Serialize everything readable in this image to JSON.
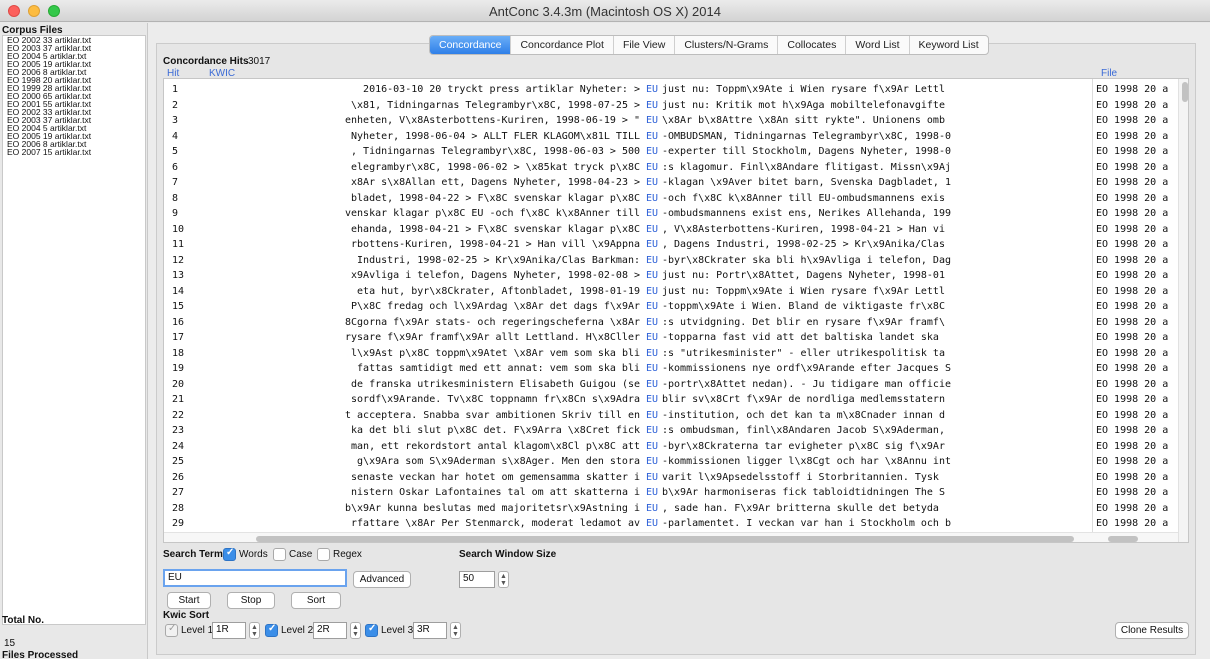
{
  "window": {
    "title": "AntConc 3.4.3m (Macintosh OS X) 2014"
  },
  "sidebar": {
    "corpus_heading": "Corpus Files",
    "files": [
      "EO 2002 33 artiklar.txt",
      "EO 2003 37 artiklar.txt",
      "EO 2004 5 artiklar.txt",
      "EO 2005 19 artiklar.txt",
      "EO 2006 8 artiklar.txt",
      "EO 1998 20 artiklar.txt",
      "EO 1999 28 artiklar.txt",
      "EO 2000 65 artiklar.txt",
      "EO 2001 55 artiklar.txt",
      "EO 2002 33 artiklar.txt",
      "EO 2003 37 artiklar.txt",
      "EO 2004 5 artiklar.txt",
      "EO 2005 19 artiklar.txt",
      "EO 2006 8 artiklar.txt",
      "EO 2007 15 artiklar.txt"
    ],
    "total_label": "Total No.",
    "total_value": "15",
    "processed_label": "Files Processed",
    "progress_fraction": 1.0
  },
  "tabs": [
    {
      "label": "Concordance",
      "active": true
    },
    {
      "label": "Concordance Plot",
      "active": false
    },
    {
      "label": "File View",
      "active": false
    },
    {
      "label": "Clusters/N-Grams",
      "active": false
    },
    {
      "label": "Collocates",
      "active": false
    },
    {
      "label": "Word List",
      "active": false
    },
    {
      "label": "Keyword List",
      "active": false
    }
  ],
  "concordance": {
    "hits_label": "Concordance Hits",
    "hits_count": "3017",
    "col_hit": "Hit",
    "col_kwic": "KWIC",
    "col_file": "File",
    "rows": [
      {
        "hit": "1",
        "left": "2016-03-10 20 tryckt press artiklar  Nyheter:  > ",
        "kw": "EU",
        "right": " just nu: Toppm\\x9Ate i Wien rysare f\\x9Ar Lettl",
        "file": "EO 1998 20 a"
      },
      {
        "hit": "2",
        "left": "\\x81, Tidningarnas Telegrambyr\\x8C, 1998-07-25  > ",
        "kw": "EU",
        "right": " just nu: Kritik mot h\\x9Aga mobiltelefonavgifte",
        "file": "EO 1998 20 a"
      },
      {
        "hit": "3",
        "left": "enheten, V\\x8Asterbottens-Kuriren, 1998-06-19  > \"",
        "kw": "EU",
        "right": " \\x8Ar b\\x8Attre \\x8An sitt rykte\". Unionens omb",
        "file": "EO 1998 20 a"
      },
      {
        "hit": "4",
        "left": "Nyheter, 1998-06-04  > ALLT FLER KLAGOM\\x81L TILL ",
        "kw": "EU",
        "right": "-OMBUDSMAN, Tidningarnas Telegrambyr\\x8C, 1998-0",
        "file": "EO 1998 20 a"
      },
      {
        "hit": "5",
        "left": ", Tidningarnas Telegrambyr\\x8C, 1998-06-03  > 500 ",
        "kw": "EU",
        "right": "-experter till Stockholm, Dagens Nyheter, 1998-0",
        "file": "EO 1998 20 a"
      },
      {
        "hit": "6",
        "left": "elegrambyr\\x8C, 1998-06-02  > \\x85kat tryck p\\x8C ",
        "kw": "EU",
        "right": ":s klagomur. Finl\\x8Andare flitigast. Missn\\x9Aj",
        "file": "EO 1998 20 a"
      },
      {
        "hit": "7",
        "left": "x8Ar s\\x8Allan ett, Dagens Nyheter, 1998-04-23  > ",
        "kw": "EU",
        "right": "-klagan \\x9Aver bitet barn, Svenska Dagbladet, 1",
        "file": "EO 1998 20 a"
      },
      {
        "hit": "8",
        "left": "bladet, 1998-04-22  > F\\x8C svenskar klagar p\\x8C ",
        "kw": "EU",
        "right": " -och f\\x8C k\\x8Anner till EU-ombudsmannens exis",
        "file": "EO 1998 20 a"
      },
      {
        "hit": "9",
        "left": "venskar klagar p\\x8C EU -och f\\x8C k\\x8Anner till ",
        "kw": "EU",
        "right": "-ombudsmannens exist ens, Nerikes Allehanda, 199",
        "file": "EO 1998 20 a"
      },
      {
        "hit": "10",
        "left": "ehanda, 1998-04-21  > F\\x8C svenskar klagar p\\x8C ",
        "kw": "EU",
        "right": ", V\\x8Asterbottens-Kuriren, 1998-04-21  > Han vi",
        "file": "EO 1998 20 a"
      },
      {
        "hit": "11",
        "left": "rbottens-Kuriren, 1998-04-21  > Han vill \\x9Appna ",
        "kw": "EU",
        "right": ", Dagens Industri, 1998-02-25  > Kr\\x9Anika/Clas",
        "file": "EO 1998 20 a"
      },
      {
        "hit": "12",
        "left": "Industri, 1998-02-25  > Kr\\x9Anika/Clas Barkman: ",
        "kw": "EU",
        "right": "-byr\\x8Ckrater ska bli h\\x9Avliga i telefon, Dag",
        "file": "EO 1998 20 a"
      },
      {
        "hit": "13",
        "left": "x9Avliga i telefon, Dagens Nyheter, 1998-02-08  > ",
        "kw": "EU",
        "right": " just nu: Portr\\x8Attet, Dagens Nyheter, 1998-01",
        "file": "EO 1998 20 a"
      },
      {
        "hit": "14",
        "left": "eta hut, byr\\x8Ckrater, Aftonbladet, 1998-01-19   ",
        "kw": "EU",
        "right": " just nu: Toppm\\x9Ate i Wien rysare f\\x9Ar Lettl",
        "file": "EO 1998 20 a"
      },
      {
        "hit": "15",
        "left": "P\\x8C fredag och l\\x9Ardag \\x8Ar det dags f\\x9Ar ",
        "kw": "EU",
        "right": "-toppm\\x9Ate i Wien. Bland  de viktigaste fr\\x8C",
        "file": "EO 1998 20 a"
      },
      {
        "hit": "16",
        "left": "8Cgorna f\\x9Ar stats- och regeringscheferna \\x8Ar ",
        "kw": "EU",
        "right": ":s utvidgning.  Det blir en rysare f\\x9Ar framf\\",
        "file": "EO 1998 20 a"
      },
      {
        "hit": "17",
        "left": "rysare f\\x9Ar framf\\x9Ar allt Lettland. H\\x8Cller ",
        "kw": "EU",
        "right": "-topparna fast vid  att det baltiska landet ska",
        "file": "EO 1998 20 a"
      },
      {
        "hit": "18",
        "left": "l\\x9Ast p\\x8C toppm\\x9Atet \\x8Ar vem som ska bli ",
        "kw": "EU",
        "right": ":s \"utrikesminister\"  - eller utrikespolitisk ta",
        "file": "EO 1998 20 a"
      },
      {
        "hit": "19",
        "left": "fattas samtidigt med ett  annat: vem som ska bli ",
        "kw": "EU",
        "right": "-kommissionens nye ordf\\x9Arande efter Jacques S",
        "file": "EO 1998 20 a"
      },
      {
        "hit": "20",
        "left": "de franska utrikesministern Elisabeth  Guigou (se ",
        "kw": "EU",
        "right": "-portr\\x8Attet nedan). - Ju tidigare man officie",
        "file": "EO 1998 20 a"
      },
      {
        "hit": "21",
        "left": "sordf\\x9Arande.  Tv\\x8C toppnamn fr\\x8Cn s\\x9Adra ",
        "kw": "EU",
        "right": " blir sv\\x8Crt f\\x9Ar de nordliga medlemsstatern",
        "file": "EO 1998 20 a"
      },
      {
        "hit": "22",
        "left": "t acceptera. Snabba svar ambitionen Skriv till en ",
        "kw": "EU",
        "right": "-institution, och det  kan ta m\\x8Cnader innan d",
        "file": "EO 1998 20 a"
      },
      {
        "hit": "23",
        "left": "ka det bli slut p\\x8C det. F\\x9Arra \\x8Cret fick ",
        "kw": "EU",
        "right": ":s ombudsman, finl\\x8Andaren Jacob S\\x9Aderman,",
        "file": "EO 1998 20 a"
      },
      {
        "hit": "24",
        "left": "man, ett rekordstort antal klagom\\x8Cl p\\x8C  att ",
        "kw": "EU",
        "right": "-byr\\x8Ckraterna tar evigheter p\\x8C sig f\\x9Ar",
        "file": "EO 1998 20 a"
      },
      {
        "hit": "25",
        "left": "g\\x9Ara som S\\x9Aderman s\\x8Ager.  Men den stora ",
        "kw": "EU",
        "right": "-kommissionen ligger l\\x8Cgt och har \\x8Annu int",
        "file": "EO 1998 20 a"
      },
      {
        "hit": "26",
        "left": "senaste veckan har hotet om gemensamma skatter i ",
        "kw": "EU",
        "right": " varit l\\x9Apsedelsstoff  i Storbritannien. Tysk",
        "file": "EO 1998 20 a"
      },
      {
        "hit": "27",
        "left": "nistern Oskar Lafontaines tal om  att skatterna i ",
        "kw": "EU",
        "right": " b\\x9Ar harmoniseras fick tabloidtidningen The S",
        "file": "EO 1998 20 a"
      },
      {
        "hit": "28",
        "left": "b\\x9Ar kunna beslutas med majoritetsr\\x9Astning i ",
        "kw": "EU",
        "right": ", sade  han. F\\x9Ar britterna skulle det betyda",
        "file": "EO 1998 20 a"
      },
      {
        "hit": "29",
        "left": "rfattare \\x8Ar Per  Stenmarck, moderat ledamot av ",
        "kw": "EU",
        "right": "-parlamentet. I veckan var han i Stockholm och b",
        "file": "EO 1998 20 a"
      }
    ]
  },
  "search": {
    "term_label": "Search Term",
    "words_label": "Words",
    "words_checked": true,
    "case_label": "Case",
    "case_checked": false,
    "regex_label": "Regex",
    "regex_checked": false,
    "term_value": "EU",
    "advanced_label": "Advanced",
    "window_label": "Search Window Size",
    "window_value": "50",
    "start_label": "Start",
    "stop_label": "Stop",
    "sort_label": "Sort"
  },
  "kwic_sort": {
    "label": "Kwic Sort",
    "level1_label": "Level 1",
    "level1_value": "1R",
    "level1_checked": true,
    "level2_label": "Level 2",
    "level2_value": "2R",
    "level2_checked": true,
    "level3_label": "Level 3",
    "level3_value": "3R",
    "level3_checked": true
  },
  "clone_label": "Clone Results",
  "colors": {
    "accent": "#3b8ee8",
    "keyword": "#2f62d8"
  }
}
